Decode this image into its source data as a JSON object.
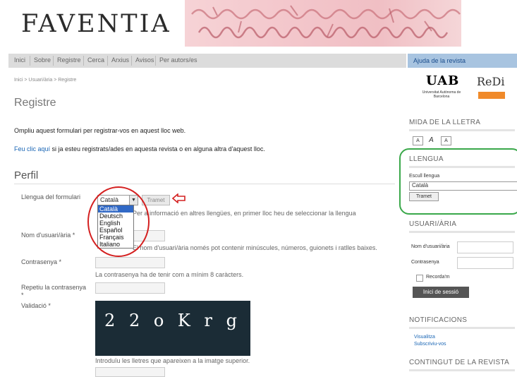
{
  "site": {
    "logo": "FAVENTIA"
  },
  "nav": {
    "items": [
      "Inici",
      "Sobre",
      "Registre",
      "Cerca",
      "Arxius",
      "Avisos",
      "Per autors/es"
    ]
  },
  "sidebar": {
    "help_label": "Ajuda de la revista",
    "uab_logo": "UAB",
    "uab_subtitle": "Universitat Autònoma de Barcelona",
    "redi_logo": "ReDi",
    "font_size_title": "MIDA DE LA LLETRA",
    "font_buttons": [
      "A",
      "A",
      "A"
    ],
    "language_title": "LLENGUA",
    "choose_language_label": "Escull llengua",
    "selected_language": "Català",
    "language_submit": "Tramet",
    "user_title": "USUARI/ÀRIA",
    "username_label": "Nom d'usuari/ària",
    "password_label": "Contrasenya",
    "remember_label": "Recorda'm",
    "login_button": "Inici de sessió",
    "notifications_title": "NOTIFICACIONS",
    "notif_links": [
      "Visualitza",
      "Subscriviu-vos"
    ],
    "content_title": "CONTINGUT DE LA REVISTA"
  },
  "main": {
    "breadcrumb": "Inici > Usuari/ària > Registre",
    "title": "Registre",
    "intro": "Ompliu aquest formulari per registrar-vos en aquest lloc web.",
    "login_link": "Feu clic aquí",
    "login_text": " si ja esteu registrats/ades en aquesta revista o en alguna altra d'aquest lloc.",
    "section_title": "Perfil",
    "form": {
      "lang_label": "Llengua del formulari",
      "lang_value": "Català",
      "submit_label": "Tramet",
      "lang_options": [
        "Català",
        "Deutsch",
        "English",
        "Español",
        "Français",
        "Italiano"
      ],
      "lang_help": "Per a informació en altres llengües, en primer lloc heu de seleccionar la llengua",
      "username_label": "Nom d'usuari/ària *",
      "username_help": "El nom d'usuari/ària només pot contenir minúscules, números, guionets i ratlles baixes.",
      "password_label": "Contrasenya *",
      "password_help": "La contrasenya ha de tenir com a mínim 8 caràcters.",
      "repeat_label": "Repetiu la contrasenya",
      "repeat_star": "*",
      "validation_label": "Validació *",
      "captcha_text": "2 2 o K r g",
      "captcha_help": "Introduïu les lletres que apareixen a la imatge superior."
    }
  },
  "annotations": {
    "oval_color": "#d42020",
    "box_color": "#3aa84a"
  }
}
